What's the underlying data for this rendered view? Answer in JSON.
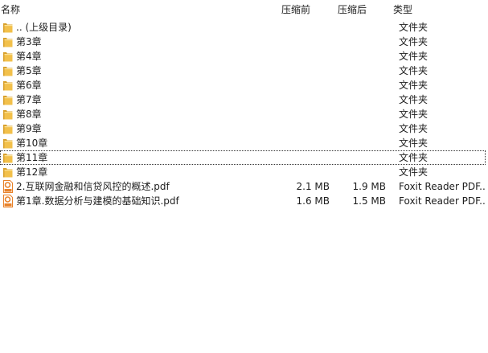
{
  "header": {
    "col_name": "名称",
    "col_size": "压缩前",
    "col_packed": "压缩后",
    "col_type": "类型"
  },
  "colors": {
    "folder": "#f2c04b",
    "folder_dark": "#d9a12c",
    "pdf_orange": "#e8822a"
  },
  "rows": [
    {
      "name": ".. (上级目录)",
      "size": "",
      "packed": "",
      "type": "文件夹",
      "icon": "folder-icon"
    },
    {
      "name": "第3章",
      "size": "",
      "packed": "",
      "type": "文件夹",
      "icon": "folder-icon"
    },
    {
      "name": "第4章",
      "size": "",
      "packed": "",
      "type": "文件夹",
      "icon": "folder-icon"
    },
    {
      "name": "第5章",
      "size": "",
      "packed": "",
      "type": "文件夹",
      "icon": "folder-icon"
    },
    {
      "name": "第6章",
      "size": "",
      "packed": "",
      "type": "文件夹",
      "icon": "folder-icon"
    },
    {
      "name": "第7章",
      "size": "",
      "packed": "",
      "type": "文件夹",
      "icon": "folder-icon"
    },
    {
      "name": "第8章",
      "size": "",
      "packed": "",
      "type": "文件夹",
      "icon": "folder-icon"
    },
    {
      "name": "第9章",
      "size": "",
      "packed": "",
      "type": "文件夹",
      "icon": "folder-icon"
    },
    {
      "name": "第10章",
      "size": "",
      "packed": "",
      "type": "文件夹",
      "icon": "folder-icon"
    },
    {
      "name": "第11章",
      "size": "",
      "packed": "",
      "type": "文件夹",
      "icon": "folder-icon",
      "focused": true
    },
    {
      "name": "第12章",
      "size": "",
      "packed": "",
      "type": "文件夹",
      "icon": "folder-icon"
    },
    {
      "name": "2.互联网金融和信贷风控的概述.pdf",
      "size": "2.1 MB",
      "packed": "1.9 MB",
      "type": "Foxit Reader PDF...",
      "icon": "pdf-icon"
    },
    {
      "name": "第1章.数据分析与建模的基础知识.pdf",
      "size": "1.6 MB",
      "packed": "1.5 MB",
      "type": "Foxit Reader PDF...",
      "icon": "pdf-icon"
    }
  ]
}
